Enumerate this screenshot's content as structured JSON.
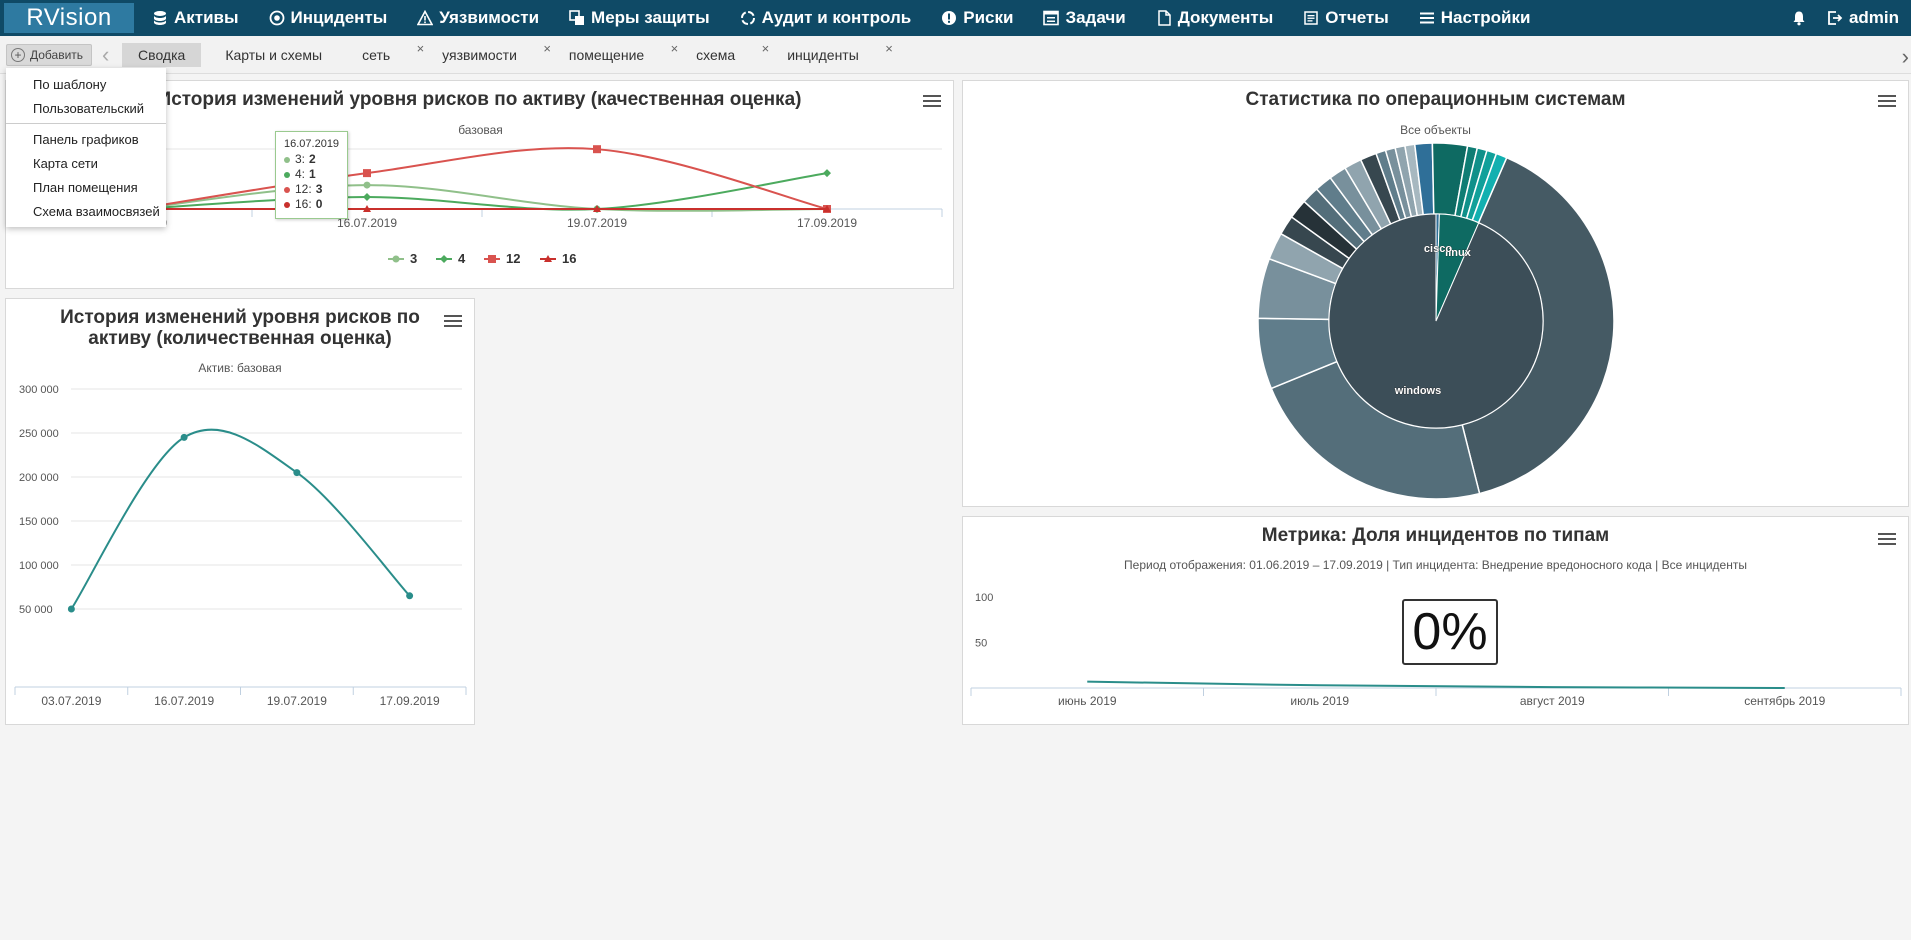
{
  "app": {
    "logo": "RVision"
  },
  "nav": [
    {
      "label": "Активы",
      "icon": "database-icon"
    },
    {
      "label": "Инциденты",
      "icon": "target-icon"
    },
    {
      "label": "Уязвимости",
      "icon": "warning-icon"
    },
    {
      "label": "Меры защиты",
      "icon": "layers-icon"
    },
    {
      "label": "Аудит и контроль",
      "icon": "refresh-icon"
    },
    {
      "label": "Риски",
      "icon": "exclamation-icon"
    },
    {
      "label": "Задачи",
      "icon": "list-icon"
    },
    {
      "label": "Документы",
      "icon": "document-icon"
    },
    {
      "label": "Отчеты",
      "icon": "report-icon"
    },
    {
      "label": "Настройки",
      "icon": "menu-icon"
    }
  ],
  "user": {
    "name": "admin"
  },
  "tabbar": {
    "add_label": "Добавить",
    "tabs": [
      {
        "label": "Сводка",
        "active": true,
        "closable": false
      },
      {
        "label": "Карты и схемы",
        "active": false,
        "closable": false
      },
      {
        "label": "сеть",
        "active": false,
        "closable": true
      },
      {
        "label": "уязвимости",
        "active": false,
        "closable": true
      },
      {
        "label": "помещение",
        "active": false,
        "closable": true
      },
      {
        "label": "схема",
        "active": false,
        "closable": true
      },
      {
        "label": "инциденты",
        "active": false,
        "closable": true
      }
    ],
    "close_glyph": "×"
  },
  "dropdown": {
    "group1": [
      "По шаблону",
      "Пользовательский"
    ],
    "group2": [
      "Панель графиков",
      "Карта сети",
      "План помещения",
      "Схема взаимосвязей"
    ]
  },
  "panel1": {
    "title": "История изменений уровня рисков по активу (качественная оценка)",
    "subtitle": "базовая",
    "tooltip": {
      "date": "16.07.2019",
      "rows": [
        {
          "label": "3:",
          "value": "2",
          "color": "#90c08a"
        },
        {
          "label": "4:",
          "value": "1",
          "color": "#4caa5e"
        },
        {
          "label": "12:",
          "value": "3",
          "color": "#d9534f"
        },
        {
          "label": "16:",
          "value": "0",
          "color": "#c9302c"
        }
      ]
    }
  },
  "panel2": {
    "title": "История изменений уровня рисков по активу (количественная оценка)",
    "subtitle": "Актив: базовая"
  },
  "panel3": {
    "title": "Статистика по операционным системам",
    "subtitle": "Все объекты"
  },
  "panel4": {
    "title": "Метрика: Доля инцидентов по типам",
    "subtitle": "Период отображения: 01.06.2019 – 17.09.2019 | Тип инцидента: Внедрение вредоносного кода | Все инциденты",
    "metric_value": "0%"
  },
  "chart_data": [
    {
      "type": "line",
      "title": "История изменений уровня рисков по активу (качественная оценка)",
      "subtitle": "базовая",
      "categories": [
        "03.07.2019",
        "16.07.2019",
        "19.07.2019",
        "17.09.2019"
      ],
      "series": [
        {
          "name": "3",
          "values": [
            0,
            2,
            0,
            0
          ],
          "color": "#90c08a",
          "marker": "circle"
        },
        {
          "name": "4",
          "values": [
            0,
            1,
            0,
            3
          ],
          "color": "#4caa5e",
          "marker": "diamond"
        },
        {
          "name": "12",
          "values": [
            0,
            3,
            5,
            0
          ],
          "color": "#d9534f",
          "marker": "square"
        },
        {
          "name": "16",
          "values": [
            0,
            0,
            0,
            0
          ],
          "color": "#c9302c",
          "marker": "triangle"
        }
      ],
      "ylim": [
        0,
        8
      ],
      "legend": "bottom"
    },
    {
      "type": "line",
      "title": "История изменений уровня рисков по активу (количественная оценка)",
      "subtitle": "Актив: базовая",
      "categories": [
        "03.07.2019",
        "16.07.2019",
        "19.07.2019",
        "17.09.2019"
      ],
      "series": [
        {
          "name": "",
          "values": [
            50000,
            245000,
            205000,
            65000
          ],
          "color": "#2a8d8a"
        }
      ],
      "yticks": [
        "50 000",
        "100 000",
        "150 000",
        "200 000",
        "250 000",
        "300 000"
      ],
      "ylim": [
        25000,
        300000
      ],
      "grid": true
    },
    {
      "type": "pie",
      "title": "Статистика по операционным системам",
      "subtitle": "Все объекты",
      "inner": [
        {
          "name": "windows",
          "value": 93,
          "color": "#3c4e58"
        },
        {
          "name": "linux",
          "value": 6,
          "color": "#0e6a62"
        },
        {
          "name": "cisco",
          "value": 0.5,
          "color": "#2f6f98"
        }
      ],
      "outer": [
        {
          "value": 40,
          "color": "#455a64"
        },
        {
          "value": 23,
          "color": "#546e7a"
        },
        {
          "value": 6.5,
          "color": "#607d8b"
        },
        {
          "value": 5.5,
          "color": "#78909c"
        },
        {
          "value": 2.5,
          "color": "#90a4ae"
        },
        {
          "value": 1.8,
          "color": "#37474f"
        },
        {
          "value": 1.8,
          "color": "#263238"
        },
        {
          "value": 1.6,
          "color": "#546e7a"
        },
        {
          "value": 1.6,
          "color": "#607d8b"
        },
        {
          "value": 1.6,
          "color": "#78909c"
        },
        {
          "value": 1.6,
          "color": "#90a4ae"
        },
        {
          "value": 1.5,
          "color": "#37474f"
        },
        {
          "value": 0.9,
          "color": "#607d8b"
        },
        {
          "value": 0.9,
          "color": "#78909c"
        },
        {
          "value": 0.9,
          "color": "#90a4ae"
        },
        {
          "value": 0.9,
          "color": "#a7b8c0"
        },
        {
          "value": 1.6,
          "color": "#2f6f98"
        },
        {
          "value": 3.2,
          "color": "#0e6a62"
        },
        {
          "value": 0.9,
          "color": "#0f7d74"
        },
        {
          "value": 0.9,
          "color": "#10908a"
        },
        {
          "value": 0.9,
          "color": "#11a09a"
        },
        {
          "value": 1.0,
          "color": "#12b0b0"
        }
      ]
    },
    {
      "type": "line",
      "title": "Метрика: Доля инцидентов по типам",
      "categories": [
        "июнь 2019",
        "июль 2019",
        "август 2019",
        "сентябрь 2019"
      ],
      "series": [
        {
          "name": "",
          "values": [
            7,
            3,
            1,
            0
          ],
          "color": "#2a8d8a"
        }
      ],
      "yticks": [
        "50",
        "100"
      ],
      "ylim": [
        0,
        110
      ]
    }
  ]
}
